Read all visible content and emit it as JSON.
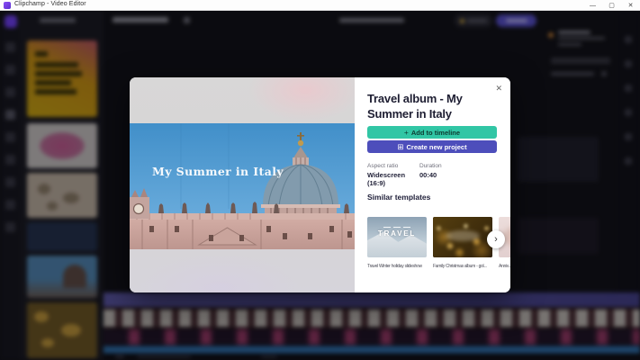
{
  "titlebar": {
    "title": "Clipchamp - Video Editor",
    "minimize_glyph": "—",
    "maximize_glyph": "▢",
    "close_glyph": "✕"
  },
  "modal": {
    "close_glyph": "✕",
    "title": "Travel album - My Summer in Italy",
    "video_title": "My Summer in Italy",
    "buttons": {
      "add_icon": "+",
      "add_label": "Add to timeline",
      "create_icon": "⊞",
      "create_label": "Create new project"
    },
    "meta": {
      "aspect_label": "Aspect ratio",
      "aspect_value": "Widescreen (16:9)",
      "duration_label": "Duration",
      "duration_value": "00:40"
    },
    "similar": {
      "heading": "Similar templates",
      "next_glyph": "›",
      "templates": [
        {
          "overlay": "TRAVEL",
          "caption": "Travel Winter holiday slideshow"
        },
        {
          "overlay": "",
          "caption": "Family Christmas album - gol..."
        },
        {
          "overlay": "",
          "caption": "Anniv..."
        }
      ]
    }
  },
  "colors": {
    "accent_teal": "#31c6a5",
    "accent_purple": "#4d4ebb",
    "app_background": "#18181e",
    "sky_blue": "#4a9bd3"
  }
}
